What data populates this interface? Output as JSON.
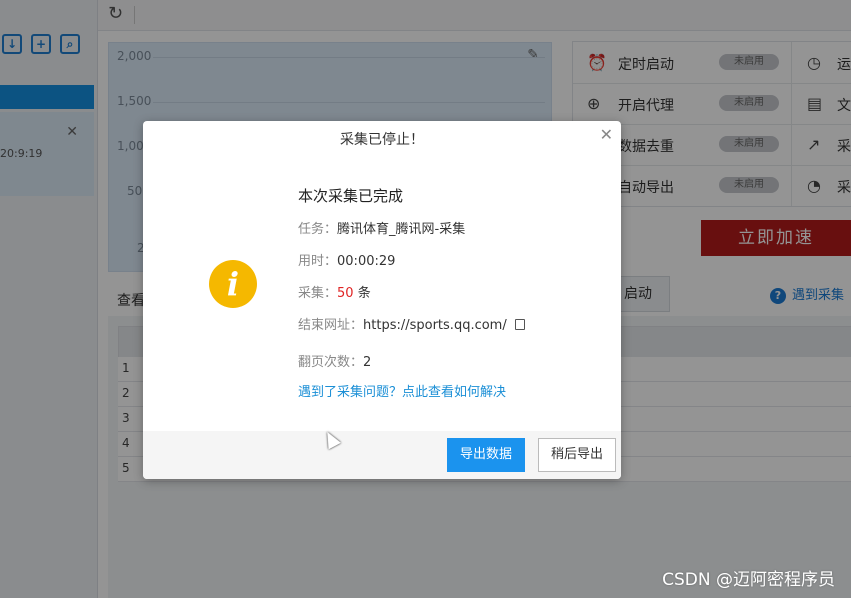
{
  "background": {
    "chart_ticks": [
      "2,000",
      "1,500",
      "1,000",
      "500",
      "2"
    ],
    "view_label": "查看",
    "settings": [
      {
        "icon": "alarm-clock-icon",
        "label": "定时启动",
        "toggle": "未启用",
        "right_icon": "clock-icon",
        "right_label": "运"
      },
      {
        "icon": "globe-icon",
        "label": "开启代理",
        "toggle": "未启用",
        "right_icon": "document-icon",
        "right_label": "文"
      },
      {
        "icon": "dedupe-icon",
        "label": "数据去重",
        "toggle": "未启用",
        "right_icon": "chart-icon",
        "right_label": "采"
      },
      {
        "icon": "export-icon",
        "label": "自动导出",
        "toggle": "未启用",
        "right_icon": "gauge-icon",
        "right_label": "采"
      }
    ],
    "accelerate_label": "立即加速",
    "start_label": "启动",
    "help_label": "遇到采集",
    "sidebar_time": "20:9:19",
    "table_rows": [
      "1",
      "2",
      "3",
      "4",
      "5"
    ],
    "watermark": "CSDN @迈阿密程序员"
  },
  "dialog": {
    "title": "采集已停止！",
    "headline": "本次采集已完成",
    "task_label": "任务：",
    "task_value": "腾讯体育_腾讯网-采集",
    "time_label": "用时：",
    "time_value": "00:00:29",
    "count_label": "采集：",
    "count_value": "50",
    "count_unit": "条",
    "end_url_label": "结束网址：",
    "end_url_value": "https://sports.qq.com/",
    "pages_label": "翻页次数：",
    "pages_value": "2",
    "help_link": "遇到了采集问题？点此查看如何解决",
    "export_button": "导出数据",
    "later_button": "稍后导出",
    "accent_color": "#1b93ee",
    "info_color": "#f5b800"
  }
}
